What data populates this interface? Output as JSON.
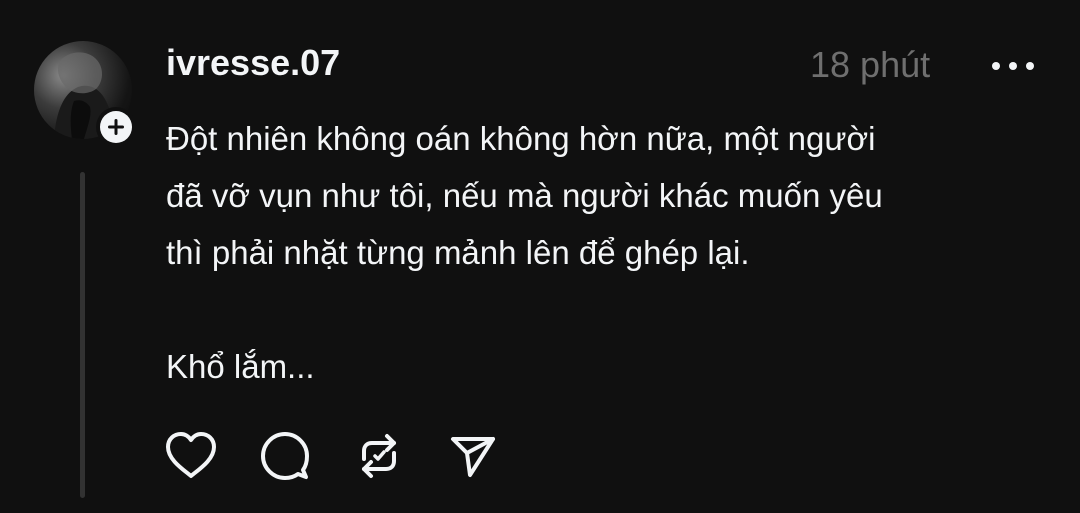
{
  "post": {
    "username": "ivresse.07",
    "timestamp": "18 phút",
    "lines": [
      "Đột nhiên không oán không hờn nữa, một người",
      "đã vỡ vụn như tôi, nếu mà người khác muốn yêu",
      "thì phải nhặt từng mảnh lên để ghép lại."
    ],
    "closing": "Khổ lắm..."
  },
  "icons": {
    "more": "more-horizontal-icon",
    "follow": "plus-icon",
    "like": "heart-icon",
    "reply": "comment-icon",
    "repost": "repost-icon",
    "share": "send-icon"
  },
  "colors": {
    "background": "#101010",
    "primary_text": "#f3f5f7",
    "secondary_text": "#6f6f6f",
    "thread_line": "#323232"
  }
}
